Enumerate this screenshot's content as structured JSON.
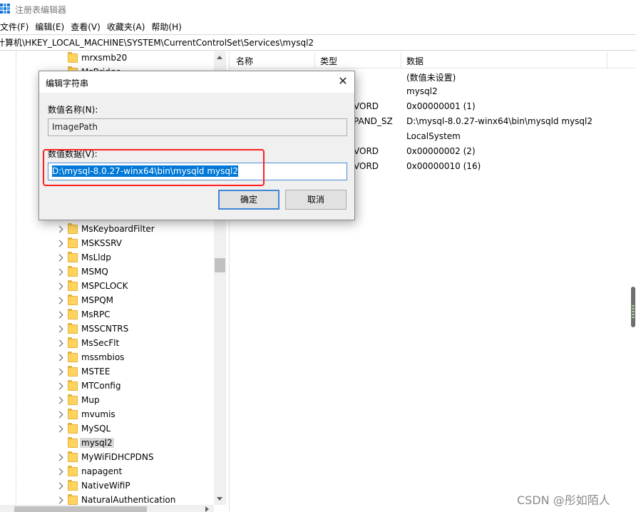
{
  "window": {
    "title": "注册表编辑器"
  },
  "menu": [
    "文件(F)",
    "编辑(E)",
    "查看(V)",
    "收藏夹(A)",
    "帮助(H)"
  ],
  "address": "计算机\\HKEY_LOCAL_MACHINE\\SYSTEM\\CurrentControlSet\\Services\\mysql2",
  "tree": {
    "items": [
      {
        "label": "mrxsmb20",
        "expandable": false,
        "selected": false
      },
      {
        "label": "MsBridge",
        "expandable": false,
        "selected": false
      },
      {
        "label": "MsKeyboardFilter",
        "expandable": true,
        "selected": false
      },
      {
        "label": "MSKSSRV",
        "expandable": true,
        "selected": false
      },
      {
        "label": "MsLldp",
        "expandable": true,
        "selected": false
      },
      {
        "label": "MSMQ",
        "expandable": true,
        "selected": false
      },
      {
        "label": "MSPCLOCK",
        "expandable": true,
        "selected": false
      },
      {
        "label": "MSPQM",
        "expandable": true,
        "selected": false
      },
      {
        "label": "MsRPC",
        "expandable": true,
        "selected": false
      },
      {
        "label": "MSSCNTRS",
        "expandable": true,
        "selected": false
      },
      {
        "label": "MsSecFlt",
        "expandable": true,
        "selected": false
      },
      {
        "label": "mssmbios",
        "expandable": true,
        "selected": false
      },
      {
        "label": "MSTEE",
        "expandable": true,
        "selected": false
      },
      {
        "label": "MTConfig",
        "expandable": true,
        "selected": false
      },
      {
        "label": "Mup",
        "expandable": true,
        "selected": false
      },
      {
        "label": "mvumis",
        "expandable": true,
        "selected": false
      },
      {
        "label": "MySQL",
        "expandable": true,
        "selected": false
      },
      {
        "label": "mysql2",
        "expandable": false,
        "selected": true
      },
      {
        "label": "MyWiFiDHCPDNS",
        "expandable": true,
        "selected": false
      },
      {
        "label": "napagent",
        "expandable": true,
        "selected": false
      },
      {
        "label": "NativeWifiP",
        "expandable": true,
        "selected": false
      },
      {
        "label": "NaturalAuthentication",
        "expandable": true,
        "selected": false
      }
    ]
  },
  "list": {
    "headers": {
      "name": "名称",
      "type": "类型",
      "data": "数据"
    },
    "rows": [
      {
        "type": "",
        "data": "(数值未设置)"
      },
      {
        "type": "",
        "data": "mysql2"
      },
      {
        "type": "VORD",
        "data": "0x00000001 (1)"
      },
      {
        "type": "PAND_SZ",
        "data": "D:\\mysql-8.0.27-winx64\\bin\\mysqld  mysql2"
      },
      {
        "type": "",
        "data": "LocalSystem"
      },
      {
        "type": "VORD",
        "data": "0x00000002 (2)"
      },
      {
        "type": "VORD",
        "data": "0x00000010 (16)"
      }
    ]
  },
  "dialog": {
    "title": "编辑字符串",
    "name_label": "数值名称(N):",
    "name_value": "ImagePath",
    "data_label": "数值数据(V):",
    "data_value": "D:\\mysql-8.0.27-winx64\\bin\\mysqld  mysql2",
    "ok_label": "确定",
    "cancel_label": "取消",
    "close_glyph": "✕"
  },
  "watermark": "CSDN @彤如陌人",
  "colors": {
    "selection": "#0078d7",
    "annotation": "#ff1e1e",
    "folder": "#ffd35c"
  }
}
